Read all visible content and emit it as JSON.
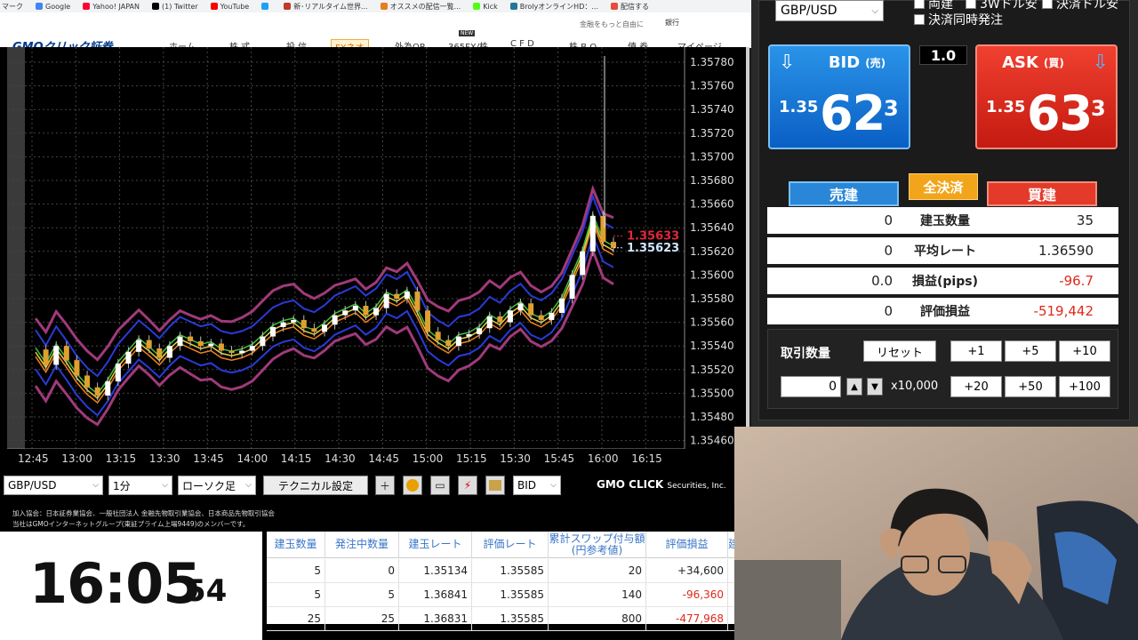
{
  "bookmarks": [
    {
      "label": "マーク",
      "color": "#888888"
    },
    {
      "label": "Google",
      "color": "#4285f4"
    },
    {
      "label": "Yahoo! JAPAN",
      "color": "#ff0033"
    },
    {
      "label": "(1) Twitter",
      "color": "#000000"
    },
    {
      "label": "YouTube",
      "color": "#ff0000"
    },
    {
      "label": "",
      "color": "#1da1f2"
    },
    {
      "label": "新･リアルタイム世界...",
      "color": "#c0392b"
    },
    {
      "label": "オススメの配信一覧...",
      "color": "#e67e22"
    },
    {
      "label": "Kick",
      "color": "#53fc18"
    },
    {
      "label": "BrolyオンラインHD：...",
      "color": "#21759b"
    },
    {
      "label": "配信する",
      "color": "#e74c3c"
    }
  ],
  "site": {
    "logo": "GMOクリック証券",
    "tagline": "金融をもっと自由に",
    "bank": "銀行",
    "nav": [
      "ホーム",
      "株 式",
      "投 信",
      "FXネオ",
      "外為OP",
      "365FX/株",
      "C F D",
      "株 B.O.",
      "債 券",
      "マイページ"
    ],
    "new_badge": "NEW"
  },
  "chart": {
    "price_labels": [
      "1.35780",
      "1.35760",
      "1.35740",
      "1.35720",
      "1.35700",
      "1.35680",
      "1.35660",
      "1.35640",
      "1.35620",
      "1.35600",
      "1.35580",
      "1.35560",
      "1.35540",
      "1.35520",
      "1.35500",
      "1.35480",
      "1.35460"
    ],
    "time_labels": [
      "12:45",
      "13:00",
      "13:15",
      "13:30",
      "13:45",
      "14:00",
      "14:15",
      "14:30",
      "14:45",
      "15:00",
      "15:15",
      "15:30",
      "15:45",
      "16:00",
      "16:15"
    ],
    "ask_tag": "1.35633",
    "bid_tag": "1.35623",
    "toolbar": {
      "pair": "GBP/USD",
      "interval": "1分",
      "chart_type": "ローソク足",
      "technical": "テクニカル設定",
      "price_side": "BID",
      "brand": "GMO CLICK",
      "brand_suffix": "Securities, Inc."
    }
  },
  "order": {
    "pair": "GBP/USD",
    "checkboxes": [
      "両建",
      "3Wドル安",
      "決済ドル安",
      "決済同時発注"
    ],
    "bid": {
      "label": "BID",
      "kanji": "(売)",
      "pre": "1.35",
      "big": "62",
      "sup": "3"
    },
    "ask": {
      "label": "ASK",
      "kanji": "(買)",
      "pre": "1.35",
      "big": "63",
      "sup": "3"
    },
    "spread": "1.0",
    "sell_tab": "売建",
    "buy_tab": "買建",
    "close_all": "全決済",
    "rows": [
      {
        "left": "0",
        "label": "建玉数量",
        "right": "35",
        "neg": false
      },
      {
        "left": "0",
        "label": "平均レート",
        "right": "1.36590",
        "neg": false
      },
      {
        "left": "0.0",
        "label": "損益(pips)",
        "right": "-96.7",
        "neg": true
      },
      {
        "left": "0",
        "label": "評価損益",
        "right": "-519,442",
        "neg": true
      }
    ],
    "qty_label": "取引数量",
    "reset": "リセット",
    "plus_row1": [
      "+1",
      "+5",
      "+10"
    ],
    "plus_row2": [
      "+20",
      "+50",
      "+100"
    ],
    "qty_value": "0",
    "qty_unit": "x10,000"
  },
  "footer_text": [
    "加入協会：日本証券業協会、一般社団法人 金融先物取引業協会、日本商品先物取引協会",
    "当社はGMOインターネットグループ(東証プライム上場9449)のメンバーです。"
  ],
  "clock": {
    "main": "16:05",
    "sec": "54"
  },
  "positions": {
    "headers": [
      "建玉数量",
      "発注中数量",
      "建玉レート",
      "評価レート",
      "累計スワップ付与額\n(円参考値)",
      "評価損益",
      "建"
    ],
    "rows": [
      [
        "5",
        "0",
        "1.35134",
        "1.35585",
        "20",
        "+34,600",
        ""
      ],
      [
        "5",
        "5",
        "1.36841",
        "1.35585",
        "140",
        "-96,360",
        ""
      ],
      [
        "25",
        "25",
        "1.36831",
        "1.35585",
        "800",
        "-477,968",
        ""
      ]
    ]
  }
}
